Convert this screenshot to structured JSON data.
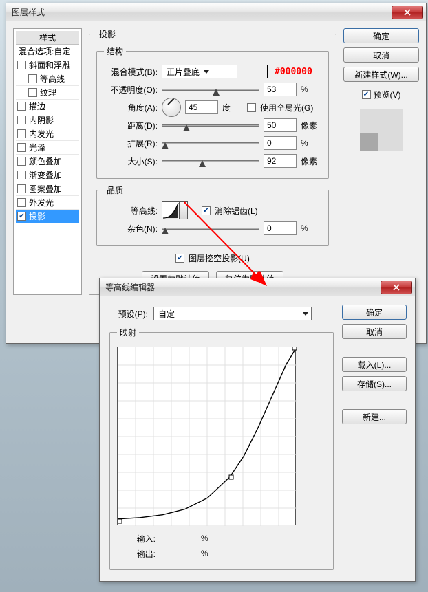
{
  "dialog1": {
    "title": "图层样式",
    "sidebar": {
      "header": "样式",
      "sub": "混合选项:自定",
      "items": [
        {
          "label": "斜面和浮雕",
          "checked": false,
          "indent": false
        },
        {
          "label": "等高线",
          "checked": false,
          "indent": true
        },
        {
          "label": "纹理",
          "checked": false,
          "indent": true
        },
        {
          "label": "描边",
          "checked": false,
          "indent": false
        },
        {
          "label": "内阴影",
          "checked": false,
          "indent": false
        },
        {
          "label": "内发光",
          "checked": false,
          "indent": false
        },
        {
          "label": "光泽",
          "checked": false,
          "indent": false
        },
        {
          "label": "颜色叠加",
          "checked": false,
          "indent": false
        },
        {
          "label": "渐变叠加",
          "checked": false,
          "indent": false
        },
        {
          "label": "图案叠加",
          "checked": false,
          "indent": false
        },
        {
          "label": "外发光",
          "checked": false,
          "indent": false
        },
        {
          "label": "投影",
          "checked": true,
          "indent": false,
          "selected": true
        }
      ]
    },
    "group_drop": "投影",
    "structure": {
      "legend": "结构",
      "blend_label": "混合模式(B):",
      "blend_value": "正片叠底",
      "color_swatch": "#000000",
      "color_anno": "#000000",
      "opacity_label": "不透明度(O):",
      "opacity_value": "53",
      "opacity_unit": "%",
      "angle_label": "角度(A):",
      "angle_value": "45",
      "angle_unit": "度",
      "global_light_label": "使用全局光(G)",
      "global_light_checked": false,
      "distance_label": "距离(D):",
      "distance_value": "50",
      "distance_unit": "像素",
      "spread_label": "扩展(R):",
      "spread_value": "0",
      "spread_unit": "%",
      "size_label": "大小(S):",
      "size_value": "92",
      "size_unit": "像素"
    },
    "quality": {
      "legend": "品质",
      "contour_label": "等高线:",
      "antialias_label": "消除锯齿(L)",
      "antialias_checked": true,
      "noise_label": "杂色(N):",
      "noise_value": "0",
      "noise_unit": "%"
    },
    "knockout_label": "图层挖空投影(U)",
    "knockout_checked": true,
    "btn_default": "设置为默认值",
    "btn_reset": "复位为默认值",
    "right": {
      "ok": "确定",
      "cancel": "取消",
      "new_style": "新建样式(W)...",
      "preview_label": "预览(V)",
      "preview_checked": true
    }
  },
  "dialog2": {
    "title": "等高线编辑器",
    "preset_label": "预设(P):",
    "preset_value": "自定",
    "map_legend": "映射",
    "input_label": "输入:",
    "input_value": "",
    "output_label": "输出:",
    "output_value": "",
    "unit": "%",
    "right": {
      "ok": "确定",
      "cancel": "取消",
      "load": "载入(L)...",
      "save": "存储(S)...",
      "new": "新建..."
    }
  },
  "chart_data": {
    "type": "line",
    "title": "映射",
    "xlabel": "输入",
    "ylabel": "输出",
    "xlim": [
      0,
      255
    ],
    "ylim": [
      0,
      255
    ],
    "x": [
      0,
      32,
      64,
      96,
      128,
      160,
      180,
      200,
      220,
      240,
      255
    ],
    "values": [
      10,
      12,
      16,
      24,
      40,
      70,
      100,
      140,
      185,
      230,
      255
    ]
  }
}
